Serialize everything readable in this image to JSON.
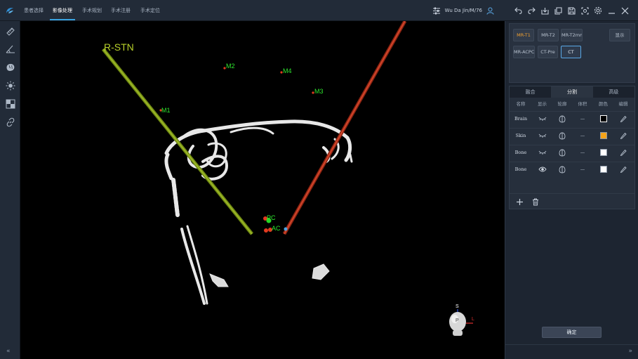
{
  "nav": {
    "tabs": [
      {
        "label": "患者选择"
      },
      {
        "label": "影像处理"
      },
      {
        "label": "手术规划"
      },
      {
        "label": "手术注册"
      },
      {
        "label": "手术定位"
      }
    ],
    "active_index": 1
  },
  "user": {
    "name": "Wu Da Jin/M/76"
  },
  "toolbar_icons": [
    "undo-icon",
    "redo-icon",
    "import-icon",
    "export-icon",
    "save-icon",
    "screenshot-icon",
    "settings-icon",
    "minimize-icon",
    "close-icon"
  ],
  "left_tools": [
    "ruler-icon",
    "angle-icon",
    "brain-icon",
    "sun-icon",
    "window-level-icon",
    "link-icon"
  ],
  "viewport": {
    "trajectories": [
      {
        "label": "R-STN",
        "color": "#8aa61a"
      },
      {
        "label": "",
        "color": "#c23a1f"
      }
    ],
    "markers": [
      {
        "label": "M1"
      },
      {
        "label": "M2"
      },
      {
        "label": "M3"
      },
      {
        "label": "M4"
      },
      {
        "label": "PC"
      },
      {
        "label": "AC"
      }
    ],
    "orientation": {
      "superior": "S",
      "posterior": "P",
      "left": "L"
    }
  },
  "sequences": {
    "items": [
      "MR-T1",
      "MR-T2",
      "MR-T2mm",
      "MR-ACPC",
      "CT-Pre",
      "CT"
    ],
    "show_label": "显示",
    "selected": "CT"
  },
  "segmentation": {
    "tabs": [
      "融合",
      "分割",
      "高级"
    ],
    "active_tab": 1,
    "headers": [
      "名称",
      "显示",
      "轮廓",
      "体积",
      "颜色",
      "编辑"
    ],
    "rows": [
      {
        "name": "Brain",
        "visible": false,
        "volume": "—",
        "color": "#000000"
      },
      {
        "name": "Skin",
        "visible": false,
        "volume": "—",
        "color": "#f5a31a"
      },
      {
        "name": "Bone",
        "visible": false,
        "volume": "—",
        "color": "#ffffff"
      },
      {
        "name": "Bone",
        "visible": true,
        "volume": "—",
        "color": "#ffffff"
      }
    ]
  },
  "confirm_label": "确定",
  "collapse_left": "«",
  "collapse_right": "»"
}
